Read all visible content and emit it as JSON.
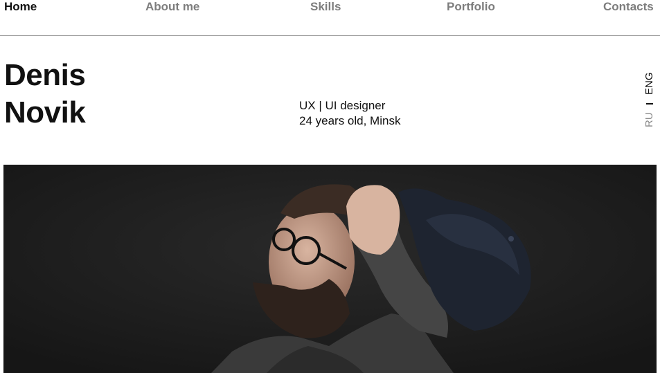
{
  "nav": {
    "items": [
      {
        "label": "Home",
        "active": true
      },
      {
        "label": "About me",
        "active": false
      },
      {
        "label": "Skills",
        "active": false
      },
      {
        "label": "Portfolio",
        "active": false
      },
      {
        "label": "Contacts",
        "active": false
      }
    ]
  },
  "hero": {
    "first_name": "Denis",
    "last_name": "Novik",
    "role": "UX | UI designer",
    "details": "24 years old, Minsk"
  },
  "language": {
    "active": "ENG",
    "inactive": "RU"
  },
  "colors": {
    "text": "#111111",
    "nav_inactive": "#7d7d7d",
    "lang_inactive": "#8a8a8a",
    "photo_background": "#1c1c1c",
    "divider": "#9a9a9a"
  }
}
